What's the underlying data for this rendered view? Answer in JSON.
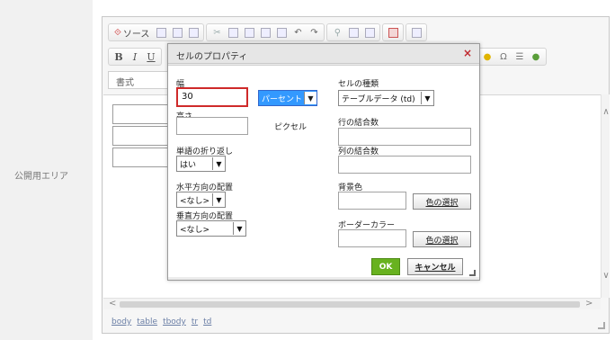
{
  "left_panel": {
    "label": "公開用エリア"
  },
  "toolbar": {
    "source_label": "ソース",
    "bold_label": "B",
    "italic_label": "I",
    "underline_label": "U",
    "format_label": "書式"
  },
  "status_bar": {
    "path": [
      "body",
      "table",
      "tbody",
      "tr",
      "td"
    ]
  },
  "dialog": {
    "title": "セルのプロパティ",
    "close_glyph": "×",
    "width": {
      "label": "幅",
      "value": "30"
    },
    "width_unit": {
      "value": "パーセント"
    },
    "height": {
      "label": "高さ",
      "value": ""
    },
    "height_unit": {
      "value": "ピクセル"
    },
    "word_wrap": {
      "label": "単語の折り返し",
      "value": "はい"
    },
    "h_align": {
      "label": "水平方向の配置",
      "value": "<なし>"
    },
    "v_align": {
      "label": "垂直方向の配置",
      "value": "<なし>"
    },
    "cell_type": {
      "label": "セルの種類",
      "value": "テーブルデータ (td)"
    },
    "rowspan": {
      "label": "行の結合数",
      "value": ""
    },
    "colspan": {
      "label": "列の結合数",
      "value": ""
    },
    "bg_color": {
      "label": "背景色",
      "value": "",
      "button": "色の選択"
    },
    "border_color": {
      "label": "ボーダーカラー",
      "value": "",
      "button": "色の選択"
    },
    "ok_label": "OK",
    "cancel_label": "キャンセル"
  },
  "colors": {
    "accent_ok": "#68b21f",
    "focus": "#cf2a2a",
    "highlight": "#3399ff",
    "close": "#c0282e"
  }
}
